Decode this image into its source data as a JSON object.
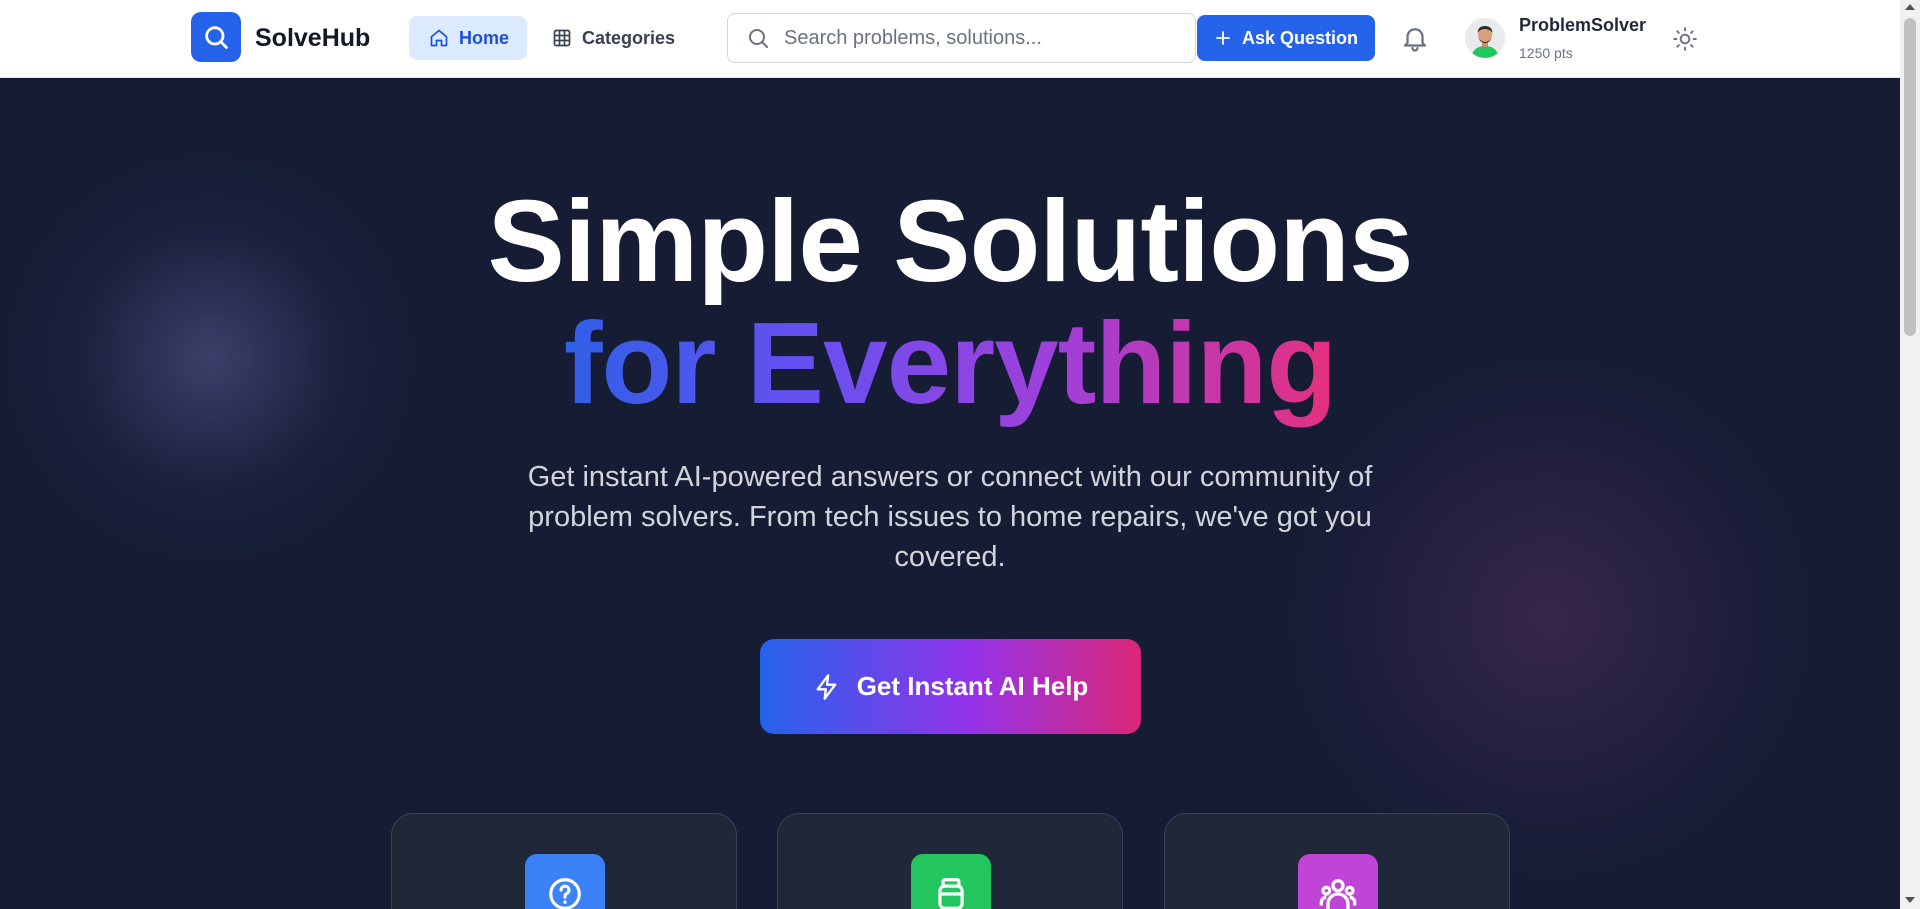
{
  "header": {
    "brand": "SolveHub",
    "nav": [
      {
        "label": "Home",
        "icon": "home-icon",
        "active": true
      },
      {
        "label": "Categories",
        "icon": "grid-icon",
        "active": false
      }
    ],
    "search": {
      "placeholder": "Search problems, solutions...",
      "value": ""
    },
    "ask_button": "Ask Question",
    "user": {
      "name": "ProblemSolver",
      "points": "1250 pts"
    }
  },
  "hero": {
    "title_line1": "Simple Solutions",
    "title_line2": "for Everything",
    "subtitle": "Get instant AI-powered answers or connect with our community of problem solvers. From tech issues to home repairs, we've got you covered.",
    "cta": "Get Instant AI Help"
  },
  "cards": [
    {
      "icon": "question-icon",
      "color": "#3b82f6"
    },
    {
      "icon": "database-icon",
      "color": "#22c55e"
    },
    {
      "icon": "community-icon",
      "color": "#c044d8"
    }
  ],
  "colors": {
    "accent": "#2563eb",
    "hero_bg": "#151c33",
    "gradient": [
      "#2563eb",
      "#9333ea",
      "#db2777"
    ]
  }
}
